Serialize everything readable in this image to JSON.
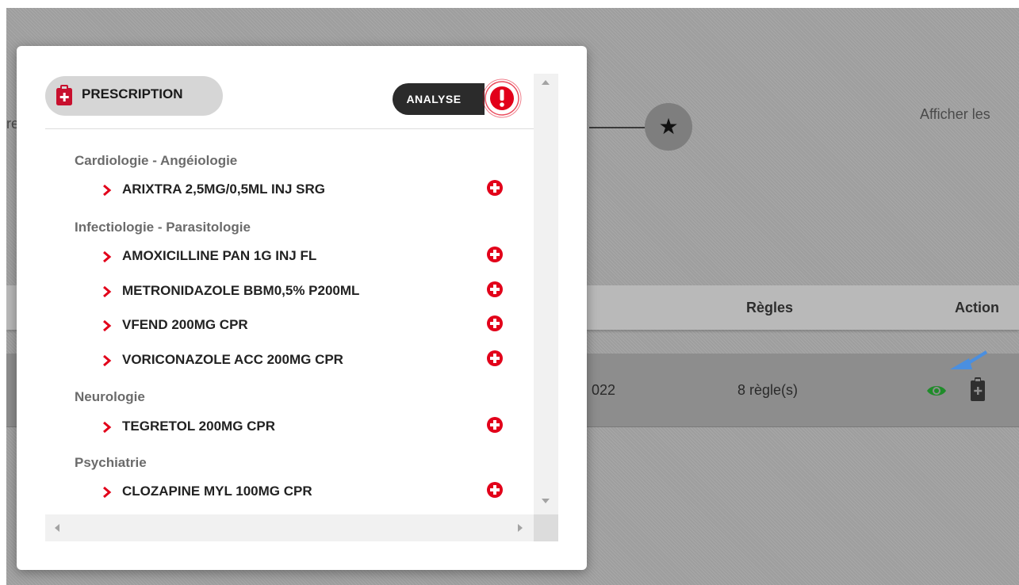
{
  "background": {
    "left_fragment": "re",
    "right_text": "Afficher les",
    "table": {
      "headers": {
        "rules": "Règles",
        "action": "Action"
      },
      "row": {
        "date_fragment": "022",
        "rules_count": "8 règle(s)"
      }
    }
  },
  "modal": {
    "prescription_label": "PRESCRIPTION",
    "analyse_label": "ANALYSE",
    "categories": [
      {
        "name": "Cardiologie - Angéiologie",
        "drugs": [
          "ARIXTRA 2,5MG/0,5ML INJ SRG"
        ]
      },
      {
        "name": "Infectiologie - Parasitologie",
        "drugs": [
          "AMOXICILLINE PAN 1G INJ FL",
          "METRONIDAZOLE BBM0,5% P200ML",
          "VFEND 200MG CPR",
          "VORICONAZOLE ACC 200MG CPR"
        ]
      },
      {
        "name": "Neurologie",
        "drugs": [
          "TEGRETOL 200MG CPR"
        ]
      },
      {
        "name": "Psychiatrie",
        "drugs": [
          "CLOZAPINE MYL 100MG CPR"
        ]
      }
    ]
  },
  "colors": {
    "accent_red": "#e2001a",
    "eye_green": "#1f8c2a",
    "arrow_blue": "#4a8fe0"
  },
  "icons": {
    "prescription": "clipboard-plus-icon",
    "alert": "exclamation-circle-icon",
    "add": "plus-circle-icon",
    "chevron": "chevron-right-icon",
    "star": "star-icon",
    "view": "eye-icon",
    "clipboard": "clipboard-icon",
    "pointer": "arrow-icon"
  }
}
